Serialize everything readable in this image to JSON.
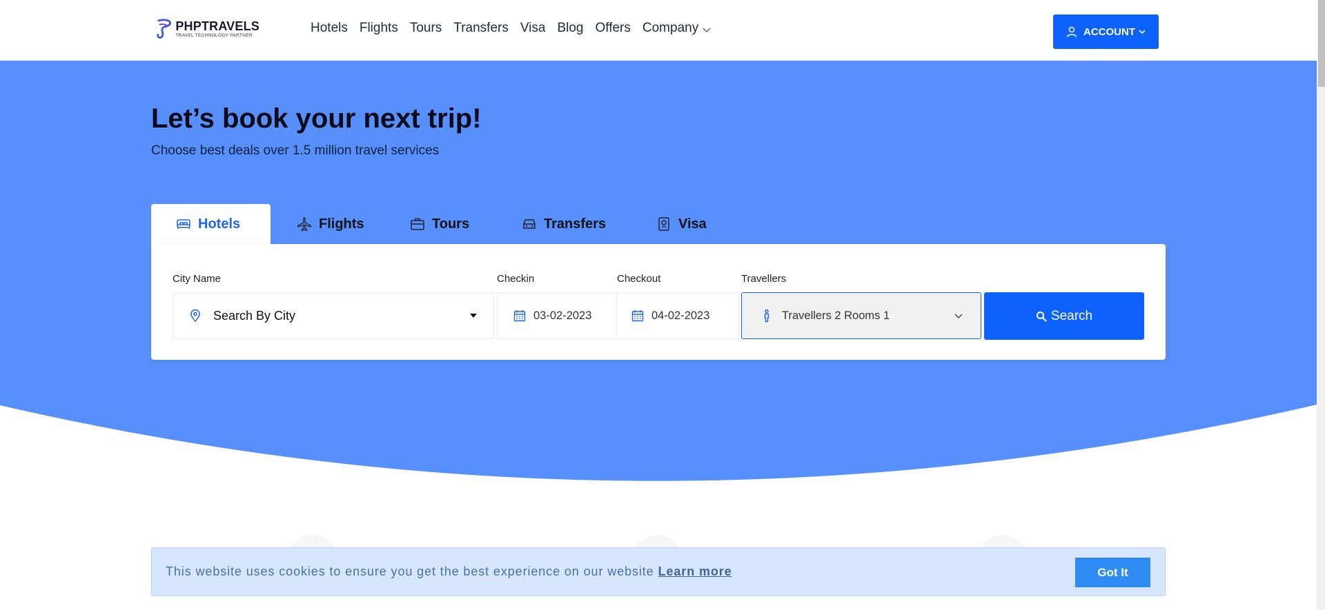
{
  "header": {
    "logo_title": "PHPTRAVELS",
    "logo_subtitle": "TRAVEL TECHNOLOGY PARTNER",
    "nav": [
      "Hotels",
      "Flights",
      "Tours",
      "Transfers",
      "Visa",
      "Blog",
      "Offers",
      "Company"
    ],
    "account_label": "ACCOUNT"
  },
  "hero": {
    "title": "Let’s book your next trip!",
    "subtitle": "Choose best deals over 1.5 million travel services"
  },
  "tabs": [
    "Hotels",
    "Flights",
    "Tours",
    "Transfers",
    "Visa"
  ],
  "search": {
    "city_label": "City Name",
    "city_value": "Search By City",
    "checkin_label": "Checkin",
    "checkin_value": "03-02-2023",
    "checkout_label": "Checkout",
    "checkout_value": "04-02-2023",
    "travellers_label": "Travellers",
    "travellers_value": "Travellers 2 Rooms 1",
    "search_label": "Search"
  },
  "cookie": {
    "text": "This website uses cookies to ensure you get the best experience on our website",
    "link": "Learn more",
    "button": "Got It"
  },
  "colors": {
    "primary": "#0d61fc",
    "hero_bg": "#578ffd",
    "cookie_bg": "#d6e6fd",
    "got_it": "#2e8bf4"
  },
  "icons": [
    "logo-icon",
    "chevron-down-icon",
    "user-icon",
    "bed-icon",
    "plane-icon",
    "suitcase-icon",
    "car-icon",
    "passport-icon",
    "location-pin-icon",
    "caret-down-icon",
    "calendar-icon",
    "person-icon",
    "search-icon"
  ]
}
